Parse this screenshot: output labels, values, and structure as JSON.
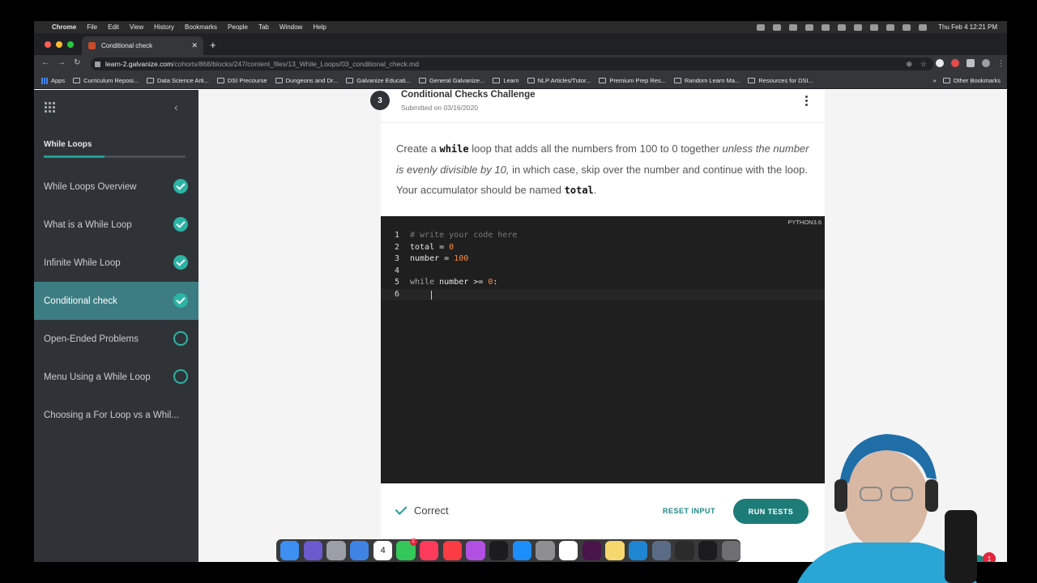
{
  "menubar": {
    "apple": "",
    "items": [
      "Chrome",
      "File",
      "Edit",
      "View",
      "History",
      "Bookmarks",
      "People",
      "Tab",
      "Window",
      "Help"
    ],
    "clock": "Thu Feb 4  12:21 PM"
  },
  "browser": {
    "tab_title": "Conditional check",
    "url_host": "learn-2.galvanize.com",
    "url_path": "/cohorts/868/blocks/247/content_files/13_While_Loops/03_conditional_check.md",
    "bookmarks": [
      "Apps",
      "Curriculum Reposi...",
      "Data Science Arti...",
      "DSI Precourse",
      "Dungeons and Dr...",
      "Galvanize Educati...",
      "General Galvanize...",
      "Learn",
      "NLP Articles/Tutor...",
      "Premium Prep Res...",
      "Random Learn Ma...",
      "Resources for DSI..."
    ],
    "bookmarks_overflow": "»",
    "other_bookmarks": "Other Bookmarks"
  },
  "sidebar": {
    "section_title": "While Loops",
    "progress": 0.43,
    "items": [
      {
        "label": "While Loops Overview",
        "status": "done"
      },
      {
        "label": "What is a While Loop",
        "status": "done"
      },
      {
        "label": "Infinite While Loop",
        "status": "done"
      },
      {
        "label": "Conditional check",
        "status": "done"
      },
      {
        "label": "Open-Ended Problems",
        "status": "open"
      },
      {
        "label": "Menu Using a While Loop",
        "status": "open"
      },
      {
        "label": "Choosing a For Loop vs a Whil...",
        "status": "none"
      }
    ]
  },
  "challenge": {
    "number": "3",
    "title": "Conditional Checks Challenge",
    "submitted": "Submitted on 03/16/2020",
    "prompt": {
      "p1": "Create a ",
      "code1": "while",
      "p2": " loop that adds all the numbers from 100 to 0 together ",
      "em": "unless the number is evenly divisible by 10,",
      "p3": " in which case, skip over the number and continue with the loop. Your accumulator should be named ",
      "code2": "total",
      "p4": "."
    },
    "language": "PYTHON3.6",
    "code_lines": [
      {
        "no": "1",
        "text": "# write your code here"
      },
      {
        "no": "2",
        "text": "total = 0"
      },
      {
        "no": "3",
        "text": "number = 100"
      },
      {
        "no": "4",
        "text": ""
      },
      {
        "no": "5",
        "text": "while number >= 0:"
      },
      {
        "no": "6",
        "text": ""
      }
    ],
    "result": "Correct",
    "reset_label": "RESET INPUT",
    "run_label": "RUN TESTS"
  },
  "chat": {
    "badge": "1"
  },
  "dock": {
    "calendar_day": "4",
    "messages_badge": "1",
    "apps": [
      "finder-icon",
      "siri-icon",
      "launchpad-icon",
      "mail-icon",
      "calendar-icon",
      "messages-icon",
      "news-icon",
      "music-icon",
      "podcasts-icon",
      "tv-icon",
      "appstore-icon",
      "settings-icon",
      "chrome-icon",
      "slack-icon",
      "notes-icon",
      "vscode-icon",
      "virtualbox-icon",
      "obs-icon",
      "terminal-icon",
      "trash-icon"
    ]
  },
  "colors": {
    "accent": "#1d7c78",
    "sidebar_bg": "#2f3338",
    "active_item": "#3c7d82",
    "done": "#2bb3a4",
    "editor_bg": "#1f1f1f",
    "number_token": "#ff8a3d"
  }
}
